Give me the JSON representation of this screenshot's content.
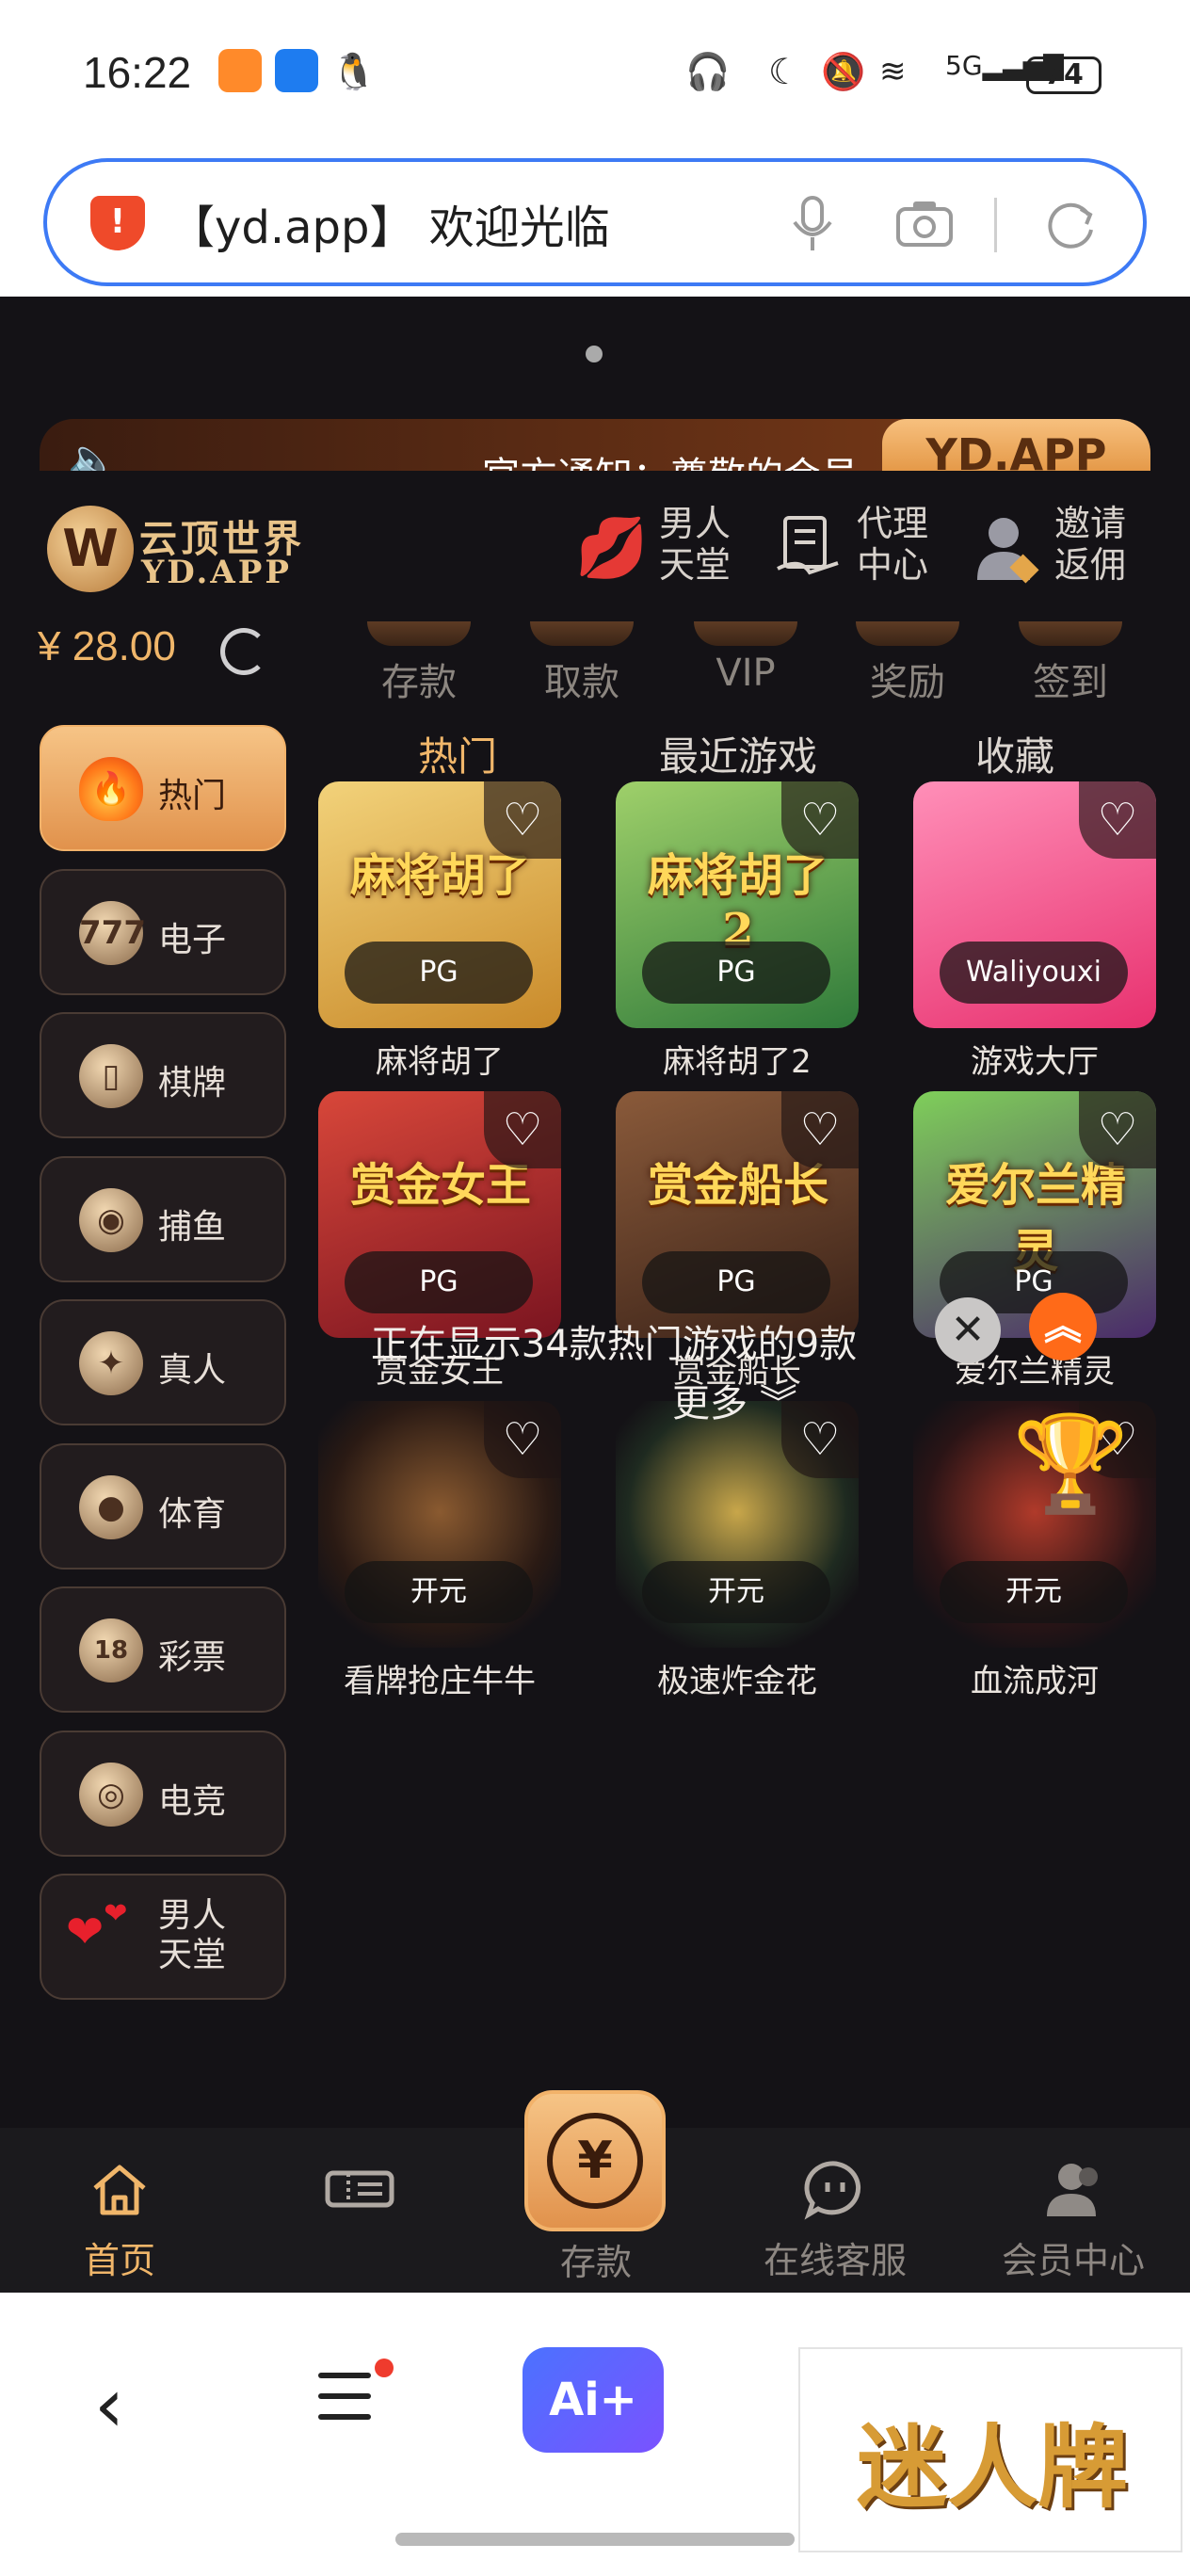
{
  "status_bar": {
    "time": "16:22",
    "network": "5G",
    "battery": "74"
  },
  "address_bar": {
    "text": "【yd.app】 欢迎光临"
  },
  "notice": {
    "text": "官方通知：尊敬的会员",
    "badge": "YD.APP"
  },
  "header": {
    "logo_cn": "云顶世界",
    "logo_en": "YD.APP",
    "nav": [
      {
        "label": "男人天堂",
        "icon": "lips-icon"
      },
      {
        "label": "代理中心",
        "icon": "agent-icon"
      },
      {
        "label": "邀请返佣",
        "icon": "invite-icon"
      }
    ]
  },
  "balance": "¥ 28.00",
  "quick_actions": [
    "存款",
    "取款",
    "VIP",
    "奖励",
    "签到"
  ],
  "sidebar": [
    {
      "label": "热门",
      "icon": "fire-icon",
      "active": true
    },
    {
      "label": "电子",
      "icon": "slot-icon"
    },
    {
      "label": "棋牌",
      "icon": "mahjong-icon"
    },
    {
      "label": "捕鱼",
      "icon": "fish-icon"
    },
    {
      "label": "真人",
      "icon": "live-icon"
    },
    {
      "label": "体育",
      "icon": "ball-icon"
    },
    {
      "label": "彩票",
      "icon": "lottery-icon"
    },
    {
      "label": "电竞",
      "icon": "esports-icon"
    },
    {
      "label": "男人天堂",
      "icon": "hearts-icon"
    }
  ],
  "tabs": [
    "热门",
    "最近游戏",
    "收藏"
  ],
  "games": [
    {
      "name": "麻将胡了",
      "provider": "PG",
      "art_title": "麻将胡了",
      "colors": [
        "#c98a2a",
        "#f2d27a"
      ]
    },
    {
      "name": "麻将胡了2",
      "provider": "PG",
      "art_title": "麻将胡了2",
      "colors": [
        "#2f7a3a",
        "#9fd06a"
      ]
    },
    {
      "name": "游戏大厅",
      "provider": "Waliyouxi",
      "art_title": "",
      "colors": [
        "#e8316f",
        "#ff8fb8"
      ]
    },
    {
      "name": "赏金女王",
      "provider": "PG",
      "art_title": "赏金女王",
      "colors": [
        "#7a1420",
        "#d8473a"
      ]
    },
    {
      "name": "赏金船长",
      "provider": "PG",
      "art_title": "赏金船长",
      "colors": [
        "#3a2218",
        "#8a5a3a"
      ]
    },
    {
      "name": "爱尔兰精灵",
      "provider": "PG",
      "art_title": "爱尔兰精灵",
      "colors": [
        "#4a2a6a",
        "#7fcf5a"
      ]
    },
    {
      "name": "看牌抢庄牛牛",
      "provider": "开元",
      "art_title": "",
      "colors": [
        "#2a1a14",
        "#8a5a30"
      ]
    },
    {
      "name": "极速炸金花",
      "provider": "开元",
      "art_title": "",
      "colors": [
        "#1e2a20",
        "#c8a64a"
      ]
    },
    {
      "name": "血流成河",
      "provider": "开元",
      "art_title": "",
      "colors": [
        "#2a1416",
        "#b03a2a"
      ]
    }
  ],
  "showing_text": "正在显示34款热门游戏的9款",
  "more_label": "更多",
  "app_nav": [
    {
      "label": "首页",
      "icon": "home-icon",
      "active": true
    },
    {
      "label": "",
      "icon": "ticket-icon"
    },
    {
      "label": "存款",
      "icon": "deposit-icon"
    },
    {
      "label": "在线客服",
      "icon": "chat-icon"
    },
    {
      "label": "会员中心",
      "icon": "user-icon"
    }
  ],
  "browser_bar": {
    "ai_label": "Ai+",
    "ad_text": "迷人牌"
  }
}
